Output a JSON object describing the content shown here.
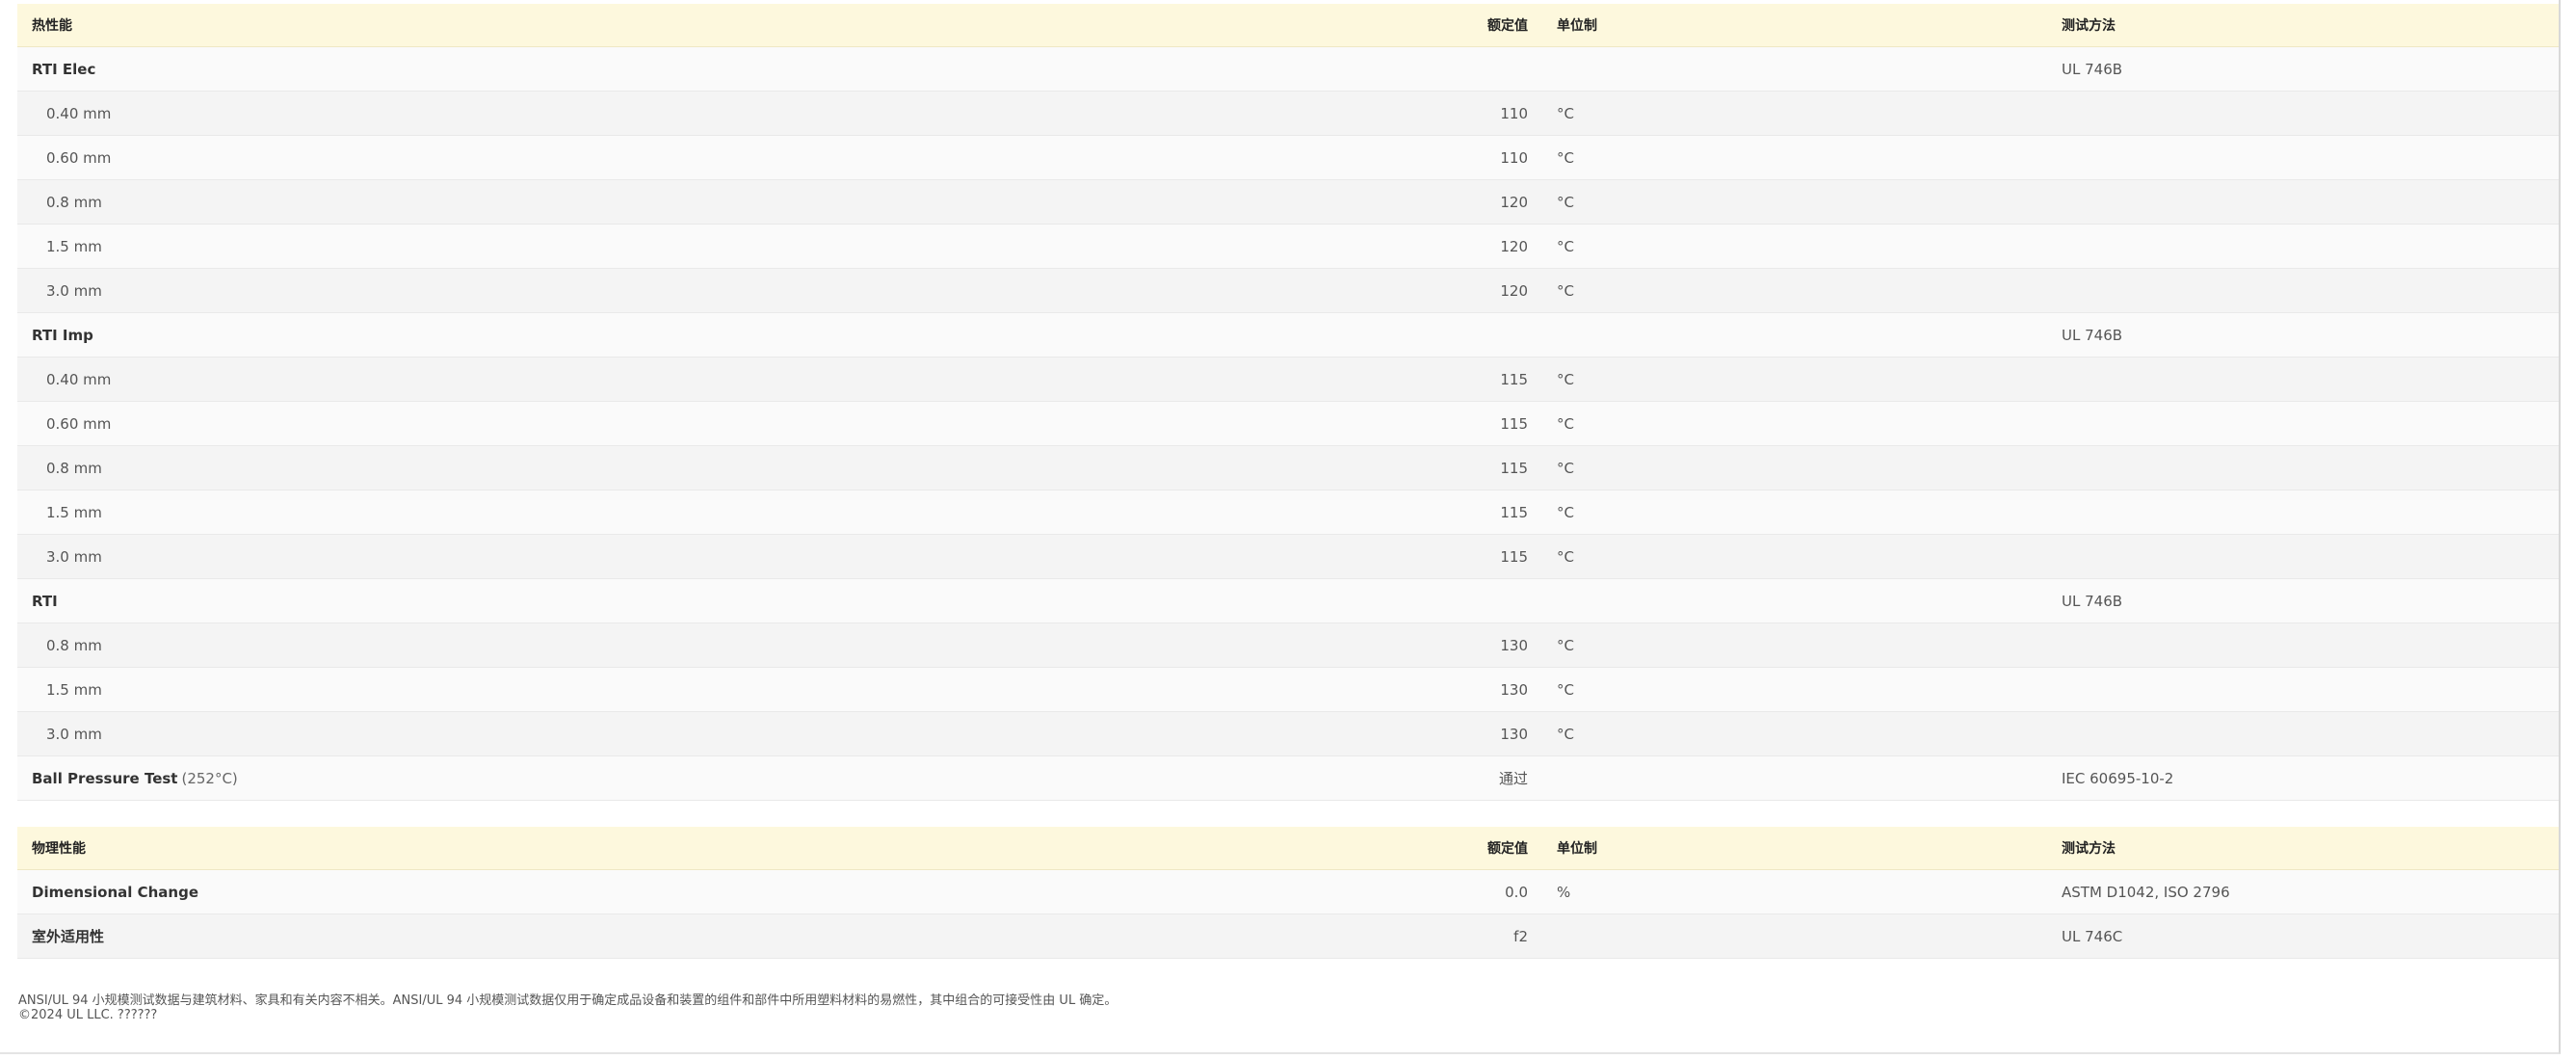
{
  "thermal": {
    "header": {
      "name": "热性能",
      "value": "额定值",
      "unit": "单位制",
      "method": "测试方法"
    },
    "rows": [
      {
        "name": "RTI Elec",
        "note": "",
        "value": "",
        "unit": "",
        "method": "UL 746B",
        "kind": "group"
      },
      {
        "name": "0.40 mm",
        "note": "",
        "value": "110",
        "unit": "°C",
        "method": "",
        "kind": "sub"
      },
      {
        "name": "0.60 mm",
        "note": "",
        "value": "110",
        "unit": "°C",
        "method": "",
        "kind": "sub"
      },
      {
        "name": "0.8 mm",
        "note": "",
        "value": "120",
        "unit": "°C",
        "method": "",
        "kind": "sub"
      },
      {
        "name": "1.5 mm",
        "note": "",
        "value": "120",
        "unit": "°C",
        "method": "",
        "kind": "sub"
      },
      {
        "name": "3.0 mm",
        "note": "",
        "value": "120",
        "unit": "°C",
        "method": "",
        "kind": "sub"
      },
      {
        "name": "RTI Imp",
        "note": "",
        "value": "",
        "unit": "",
        "method": "UL 746B",
        "kind": "group"
      },
      {
        "name": "0.40 mm",
        "note": "",
        "value": "115",
        "unit": "°C",
        "method": "",
        "kind": "sub"
      },
      {
        "name": "0.60 mm",
        "note": "",
        "value": "115",
        "unit": "°C",
        "method": "",
        "kind": "sub"
      },
      {
        "name": "0.8 mm",
        "note": "",
        "value": "115",
        "unit": "°C",
        "method": "",
        "kind": "sub"
      },
      {
        "name": "1.5 mm",
        "note": "",
        "value": "115",
        "unit": "°C",
        "method": "",
        "kind": "sub"
      },
      {
        "name": "3.0 mm",
        "note": "",
        "value": "115",
        "unit": "°C",
        "method": "",
        "kind": "sub"
      },
      {
        "name": "RTI",
        "note": "",
        "value": "",
        "unit": "",
        "method": "UL 746B",
        "kind": "group"
      },
      {
        "name": "0.8 mm",
        "note": "",
        "value": "130",
        "unit": "°C",
        "method": "",
        "kind": "sub"
      },
      {
        "name": "1.5 mm",
        "note": "",
        "value": "130",
        "unit": "°C",
        "method": "",
        "kind": "sub"
      },
      {
        "name": "3.0 mm",
        "note": "",
        "value": "130",
        "unit": "°C",
        "method": "",
        "kind": "sub"
      },
      {
        "name": "Ball Pressure Test",
        "note": "(252°C)",
        "value": "通过",
        "unit": "",
        "method": "IEC 60695-10-2",
        "kind": "group"
      }
    ]
  },
  "physical": {
    "header": {
      "name": "物理性能",
      "value": "额定值",
      "unit": "单位制",
      "method": "测试方法"
    },
    "rows": [
      {
        "name": "Dimensional Change",
        "note": "",
        "value": "0.0",
        "unit": "%",
        "method": "ASTM D1042, ISO 2796",
        "kind": "group"
      },
      {
        "name": "室外适用性",
        "note": "",
        "value": "f2",
        "unit": "",
        "method": "UL 746C",
        "kind": "group"
      }
    ]
  },
  "footer": {
    "disclaimer": "ANSI/UL 94 小规模测试数据与建筑材料、家具和有关内容不相关。ANSI/UL 94 小规模测试数据仅用于确定成品设备和装置的组件和部件中所用塑料材料的易燃性，其中组合的可接受性由 UL 确定。",
    "copyright": "©2024 UL LLC. ??????"
  }
}
